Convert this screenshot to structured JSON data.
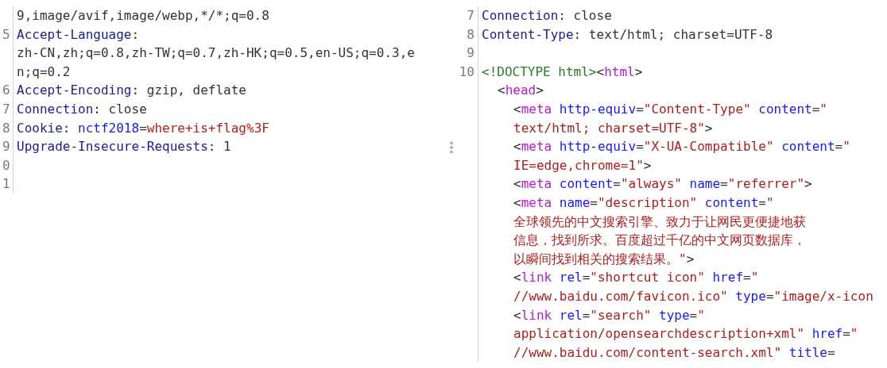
{
  "request": {
    "lines": [
      {
        "segments": [
          {
            "kind": "value",
            "text": "9,image/avif,image/webp,*/*;q=0.8"
          }
        ]
      },
      {
        "number": "5",
        "segments": [
          {
            "kind": "header-name",
            "text": "Accept-Language"
          },
          {
            "kind": "punct",
            "text": ":"
          }
        ]
      },
      {
        "segments": [
          {
            "kind": "value",
            "text": "zh-CN,zh;q=0.8,zh-TW;q=0.7,zh-HK;q=0.5,en-US;q=0.3,e"
          }
        ]
      },
      {
        "segments": [
          {
            "kind": "value",
            "text": "n;q=0.2"
          }
        ]
      },
      {
        "number": "6",
        "segments": [
          {
            "kind": "header-name",
            "text": "Accept-Encoding"
          },
          {
            "kind": "punct",
            "text": ": "
          },
          {
            "kind": "value",
            "text": "gzip, deflate"
          }
        ]
      },
      {
        "number": "7",
        "segments": [
          {
            "kind": "header-name",
            "text": "Connection"
          },
          {
            "kind": "punct",
            "text": ": "
          },
          {
            "kind": "value",
            "text": "close"
          }
        ]
      },
      {
        "number": "8",
        "segments": [
          {
            "kind": "header-name",
            "text": "Cookie"
          },
          {
            "kind": "punct",
            "text": ": "
          },
          {
            "kind": "cookie-name",
            "text": "nctf2018"
          },
          {
            "kind": "punct",
            "text": "="
          },
          {
            "kind": "cookie-value",
            "text": "where+is+flag%3F"
          }
        ]
      },
      {
        "number": "9",
        "segments": [
          {
            "kind": "header-name",
            "text": "Upgrade-Insecure-Requests"
          },
          {
            "kind": "punct",
            "text": ": "
          },
          {
            "kind": "value",
            "text": "1"
          }
        ]
      },
      {
        "number": "0"
      },
      {
        "number": "1"
      }
    ]
  },
  "response": {
    "lines": [
      {
        "number": "7",
        "segments": [
          {
            "kind": "header-name",
            "text": "Connection"
          },
          {
            "kind": "punct",
            "text": ": "
          },
          {
            "kind": "value",
            "text": "close"
          }
        ]
      },
      {
        "number": "8",
        "segments": [
          {
            "kind": "header-name",
            "text": "Content-Type"
          },
          {
            "kind": "punct",
            "text": ": "
          },
          {
            "kind": "value",
            "text": "text/html; charset=UTF-8"
          }
        ]
      },
      {
        "number": "9"
      },
      {
        "number": "10",
        "segments": [
          {
            "kind": "doctype",
            "text": "<!DOCTYPE html>"
          },
          {
            "kind": "punct",
            "text": "<"
          },
          {
            "kind": "tag",
            "text": "html"
          },
          {
            "kind": "punct",
            "text": ">"
          }
        ],
        "children": [
          {
            "segments": [
              {
                "kind": "punct",
                "text": "<"
              },
              {
                "kind": "tag",
                "text": "head"
              },
              {
                "kind": "punct",
                "text": ">"
              }
            ],
            "children": [
              {
                "segments": [
                  {
                    "kind": "punct",
                    "text": "<"
                  },
                  {
                    "kind": "tag",
                    "text": "meta"
                  },
                  {
                    "kind": "attr",
                    "text": " http-equiv"
                  },
                  {
                    "kind": "punct",
                    "text": "="
                  },
                  {
                    "kind": "attr-value",
                    "text": "\"Content-Type\""
                  },
                  {
                    "kind": "attr",
                    "text": " content"
                  },
                  {
                    "kind": "punct",
                    "text": "="
                  },
                  {
                    "kind": "attr-value",
                    "text": "\""
                  }
                ]
              },
              {
                "segments": [
                  {
                    "kind": "attr-value",
                    "text": "text/html; charset=UTF-8\""
                  },
                  {
                    "kind": "punct",
                    "text": ">"
                  }
                ]
              },
              {
                "segments": [
                  {
                    "kind": "punct",
                    "text": "<"
                  },
                  {
                    "kind": "tag",
                    "text": "meta"
                  },
                  {
                    "kind": "attr",
                    "text": " http-equiv"
                  },
                  {
                    "kind": "punct",
                    "text": "="
                  },
                  {
                    "kind": "attr-value",
                    "text": "\"X-UA-Compatible\""
                  },
                  {
                    "kind": "attr",
                    "text": " content"
                  },
                  {
                    "kind": "punct",
                    "text": "="
                  },
                  {
                    "kind": "attr-value",
                    "text": "\""
                  }
                ]
              },
              {
                "segments": [
                  {
                    "kind": "attr-value",
                    "text": "IE=edge,chrome=1\""
                  },
                  {
                    "kind": "punct",
                    "text": ">"
                  }
                ]
              },
              {
                "segments": [
                  {
                    "kind": "punct",
                    "text": "<"
                  },
                  {
                    "kind": "tag",
                    "text": "meta"
                  },
                  {
                    "kind": "attr",
                    "text": " content"
                  },
                  {
                    "kind": "punct",
                    "text": "="
                  },
                  {
                    "kind": "attr-value",
                    "text": "\"always\""
                  },
                  {
                    "kind": "attr",
                    "text": " name"
                  },
                  {
                    "kind": "punct",
                    "text": "="
                  },
                  {
                    "kind": "attr-value",
                    "text": "\"referrer\""
                  },
                  {
                    "kind": "punct",
                    "text": ">"
                  }
                ]
              },
              {
                "segments": [
                  {
                    "kind": "punct",
                    "text": "<"
                  },
                  {
                    "kind": "tag",
                    "text": "meta"
                  },
                  {
                    "kind": "attr",
                    "text": " name"
                  },
                  {
                    "kind": "punct",
                    "text": "="
                  },
                  {
                    "kind": "attr-value",
                    "text": "\"description\""
                  },
                  {
                    "kind": "attr",
                    "text": " content"
                  },
                  {
                    "kind": "punct",
                    "text": "="
                  },
                  {
                    "kind": "attr-value",
                    "text": "\""
                  }
                ]
              },
              {
                "segments": [
                  {
                    "kind": "attr-value",
                    "text": "全球领先的中文搜索引擎、致力于让网民更便捷地获"
                  }
                ]
              },
              {
                "segments": [
                  {
                    "kind": "attr-value",
                    "text": "信息，找到所求。百度超过千亿的中文网页数据库，"
                  }
                ]
              },
              {
                "segments": [
                  {
                    "kind": "attr-value",
                    "text": "以瞬间找到相关的搜索结果。\""
                  },
                  {
                    "kind": "punct",
                    "text": ">"
                  }
                ]
              },
              {
                "segments": [
                  {
                    "kind": "punct",
                    "text": "<"
                  },
                  {
                    "kind": "tag",
                    "text": "link"
                  },
                  {
                    "kind": "attr",
                    "text": " rel"
                  },
                  {
                    "kind": "punct",
                    "text": "="
                  },
                  {
                    "kind": "attr-value",
                    "text": "\"shortcut icon\""
                  },
                  {
                    "kind": "attr",
                    "text": " href"
                  },
                  {
                    "kind": "punct",
                    "text": "="
                  },
                  {
                    "kind": "attr-value",
                    "text": "\""
                  }
                ]
              },
              {
                "segments": [
                  {
                    "kind": "attr-value",
                    "text": "//www.baidu.com/favicon.ico\""
                  },
                  {
                    "kind": "attr",
                    "text": " type"
                  },
                  {
                    "kind": "punct",
                    "text": "="
                  },
                  {
                    "kind": "attr-value",
                    "text": "\"image/x-icon"
                  }
                ]
              },
              {
                "segments": [
                  {
                    "kind": "punct",
                    "text": "<"
                  },
                  {
                    "kind": "tag",
                    "text": "link"
                  },
                  {
                    "kind": "attr",
                    "text": " rel"
                  },
                  {
                    "kind": "punct",
                    "text": "="
                  },
                  {
                    "kind": "attr-value",
                    "text": "\"search\""
                  },
                  {
                    "kind": "attr",
                    "text": " type"
                  },
                  {
                    "kind": "punct",
                    "text": "="
                  },
                  {
                    "kind": "attr-value",
                    "text": "\""
                  }
                ]
              },
              {
                "segments": [
                  {
                    "kind": "attr-value",
                    "text": "application/opensearchdescription+xml\""
                  },
                  {
                    "kind": "attr",
                    "text": " href"
                  },
                  {
                    "kind": "punct",
                    "text": "="
                  },
                  {
                    "kind": "attr-value",
                    "text": "\""
                  }
                ]
              },
              {
                "segments": [
                  {
                    "kind": "attr-value",
                    "text": "//www.baidu.com/content-search.xml\""
                  },
                  {
                    "kind": "attr",
                    "text": " title"
                  },
                  {
                    "kind": "punct",
                    "text": "="
                  }
                ]
              }
            ]
          }
        ]
      }
    ]
  }
}
